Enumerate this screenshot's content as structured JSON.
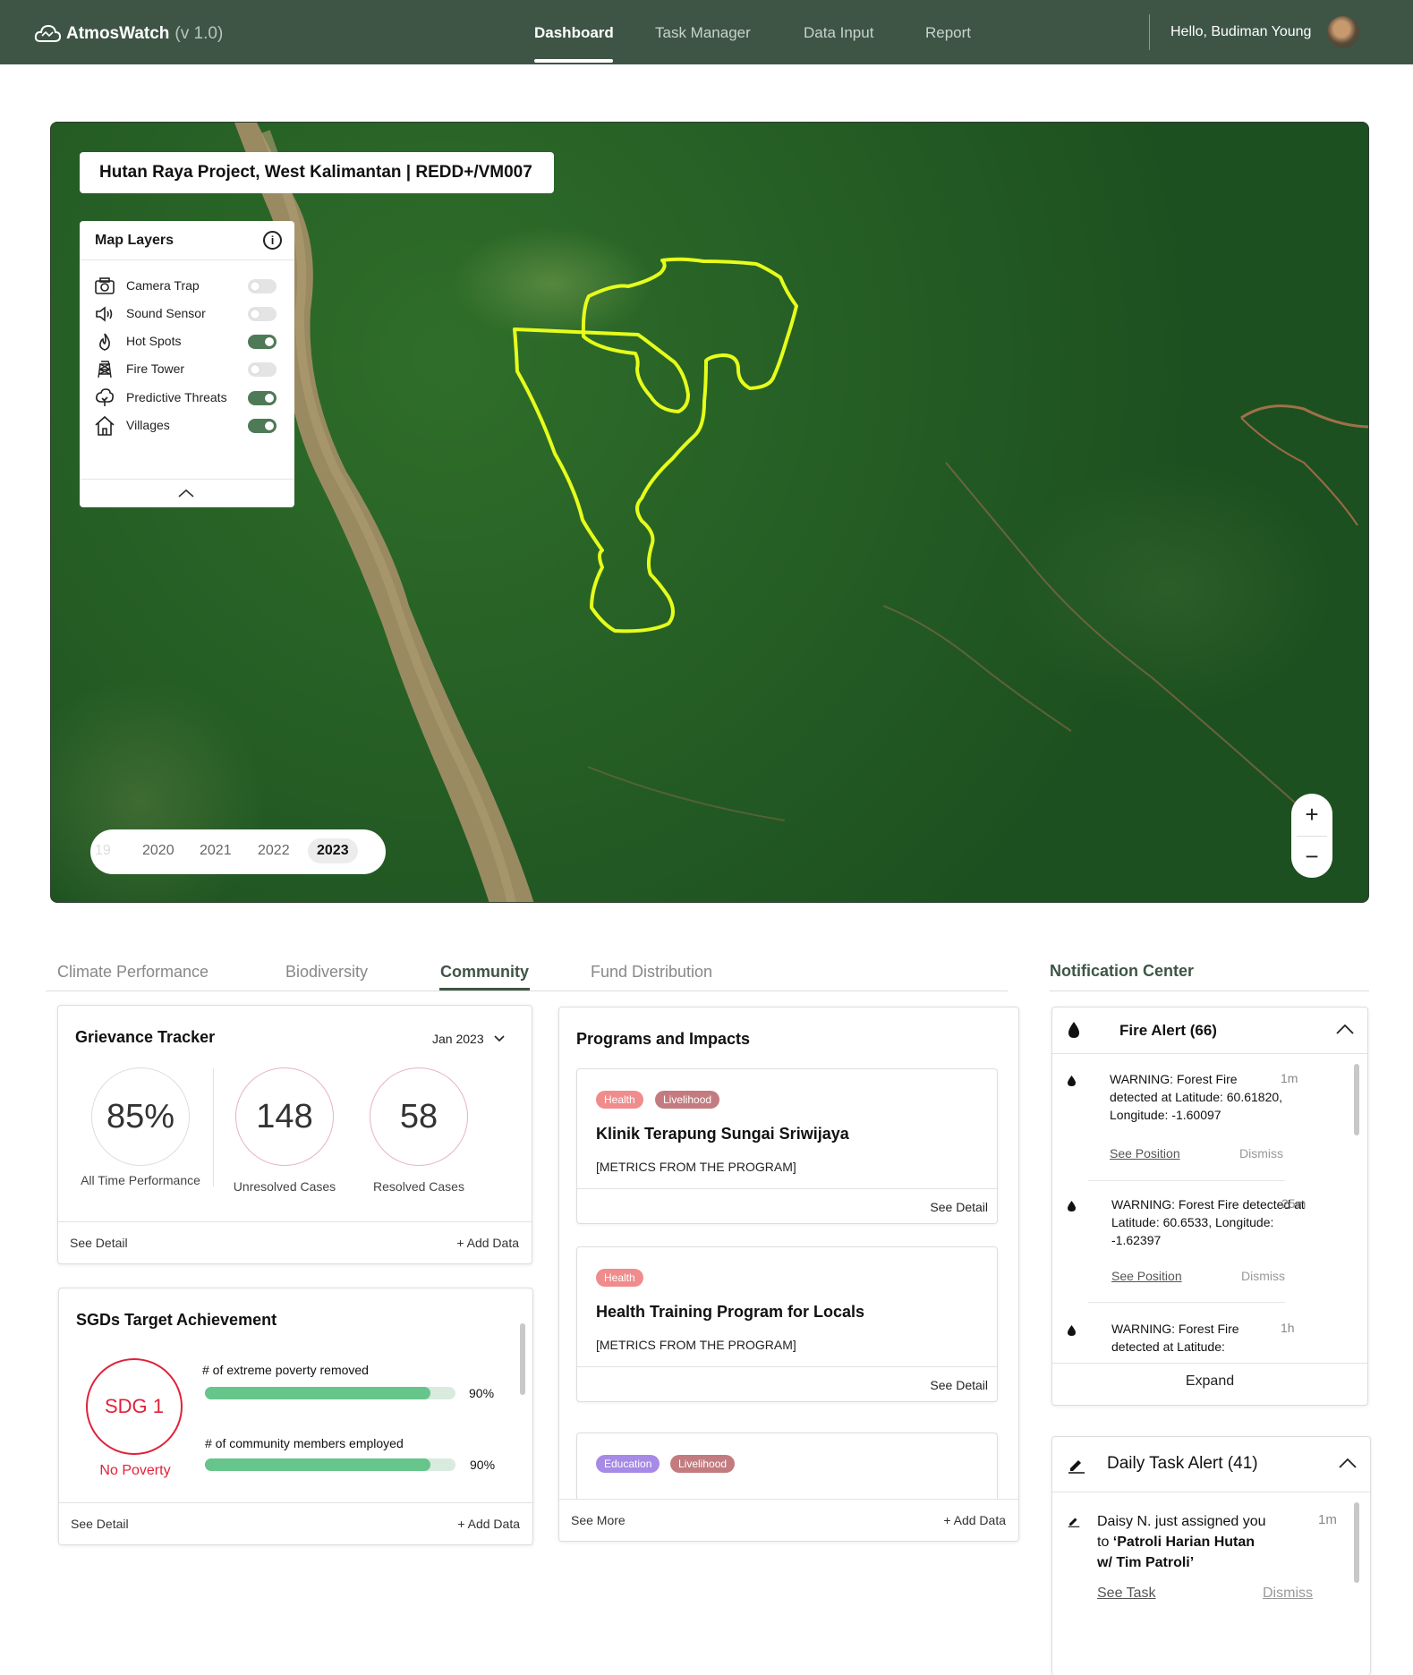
{
  "app": {
    "name": "AtmosWatch",
    "version": "(v 1.0)"
  },
  "nav": {
    "items": [
      "Dashboard",
      "Task Manager",
      "Data Input",
      "Report"
    ],
    "active": "Dashboard"
  },
  "user": {
    "greeting": "Hello, Budiman Young"
  },
  "map": {
    "project_title": "Hutan Raya Project, West Kalimantan  |  REDD+/VM007",
    "layers_title": "Map Layers",
    "layers": [
      {
        "label": "Camera Trap",
        "icon": "camera-icon",
        "on": false
      },
      {
        "label": "Sound Sensor",
        "icon": "speaker-icon",
        "on": false
      },
      {
        "label": "Hot Spots",
        "icon": "flame-icon",
        "on": true
      },
      {
        "label": "Fire Tower",
        "icon": "tower-icon",
        "on": false
      },
      {
        "label": "Predictive Threats",
        "icon": "tree-icon",
        "on": true
      },
      {
        "label": "Villages",
        "icon": "house-icon",
        "on": true
      }
    ],
    "years": [
      "19",
      "2020",
      "2021",
      "2022",
      "2023"
    ],
    "selected_year": "2023",
    "zoom_in": "+",
    "zoom_out": "−",
    "boundary_color": "#e6ff1a"
  },
  "tabs": {
    "items": [
      "Climate Performance",
      "Biodiversity",
      "Community",
      "Fund Distribution"
    ],
    "active": "Community"
  },
  "grievance": {
    "title": "Grievance Tracker",
    "period": "Jan 2023",
    "stats": [
      {
        "value": "85%",
        "label": "All Time Performance"
      },
      {
        "value": "148",
        "label": "Unresolved Cases"
      },
      {
        "value": "58",
        "label": "Resolved Cases"
      }
    ],
    "see_detail": "See Detail",
    "add_data": "+ Add Data"
  },
  "sdg": {
    "title": "SGDs Target Achievement",
    "badge": "SDG 1",
    "badge_label": "No Poverty",
    "metrics": [
      {
        "label": "# of extreme poverty removed",
        "value": 0.9,
        "pct": "90%"
      },
      {
        "label": "# of community members employed",
        "value": 0.9,
        "pct": "90%"
      }
    ],
    "see_detail": "See Detail",
    "add_data": "+ Add Data",
    "bar_color": "#66c58a"
  },
  "programs": {
    "title": "Programs and Impacts",
    "items": [
      {
        "tags": [
          "Health",
          "Livelihood"
        ],
        "title": "Klinik Terapung Sungai Sriwijaya",
        "metrics": "[METRICS FROM THE PROGRAM]",
        "detail": "See Detail"
      },
      {
        "tags": [
          "Health"
        ],
        "title": "Health Training Program for Locals",
        "metrics": "[METRICS FROM THE PROGRAM]",
        "detail": "See Detail"
      },
      {
        "tags": [
          "Education",
          "Livelihood"
        ]
      }
    ],
    "see_more": "See More",
    "add_data": "+ Add Data"
  },
  "notifications": {
    "title": "Notification Center",
    "fire": {
      "title": "Fire Alert (66)",
      "alerts": [
        {
          "msg": "WARNING: Forest Fire detected at Latitude: 60.61820, Longitude: -1.60097",
          "time": "1m",
          "see": "See Position",
          "dismiss": "Dismiss"
        },
        {
          "msg": "WARNING: Forest Fire detected at Latitude: 60.6533, Longitude: -1.62397",
          "time": "25m",
          "see": "See Position",
          "dismiss": "Dismiss"
        },
        {
          "msg": "WARNING: Forest Fire detected at Latitude:",
          "time": "1h"
        }
      ],
      "expand": "Expand"
    },
    "task": {
      "title": "Daily Task Alert (41)",
      "alerts": [
        {
          "msg_prefix": "Daisy N. just assigned you to ",
          "msg_bold": "‘Patroli Harian Hutan w/ Tim Patroli’",
          "time": "1m",
          "see": "See Task",
          "dismiss": "Dismiss"
        }
      ]
    }
  }
}
